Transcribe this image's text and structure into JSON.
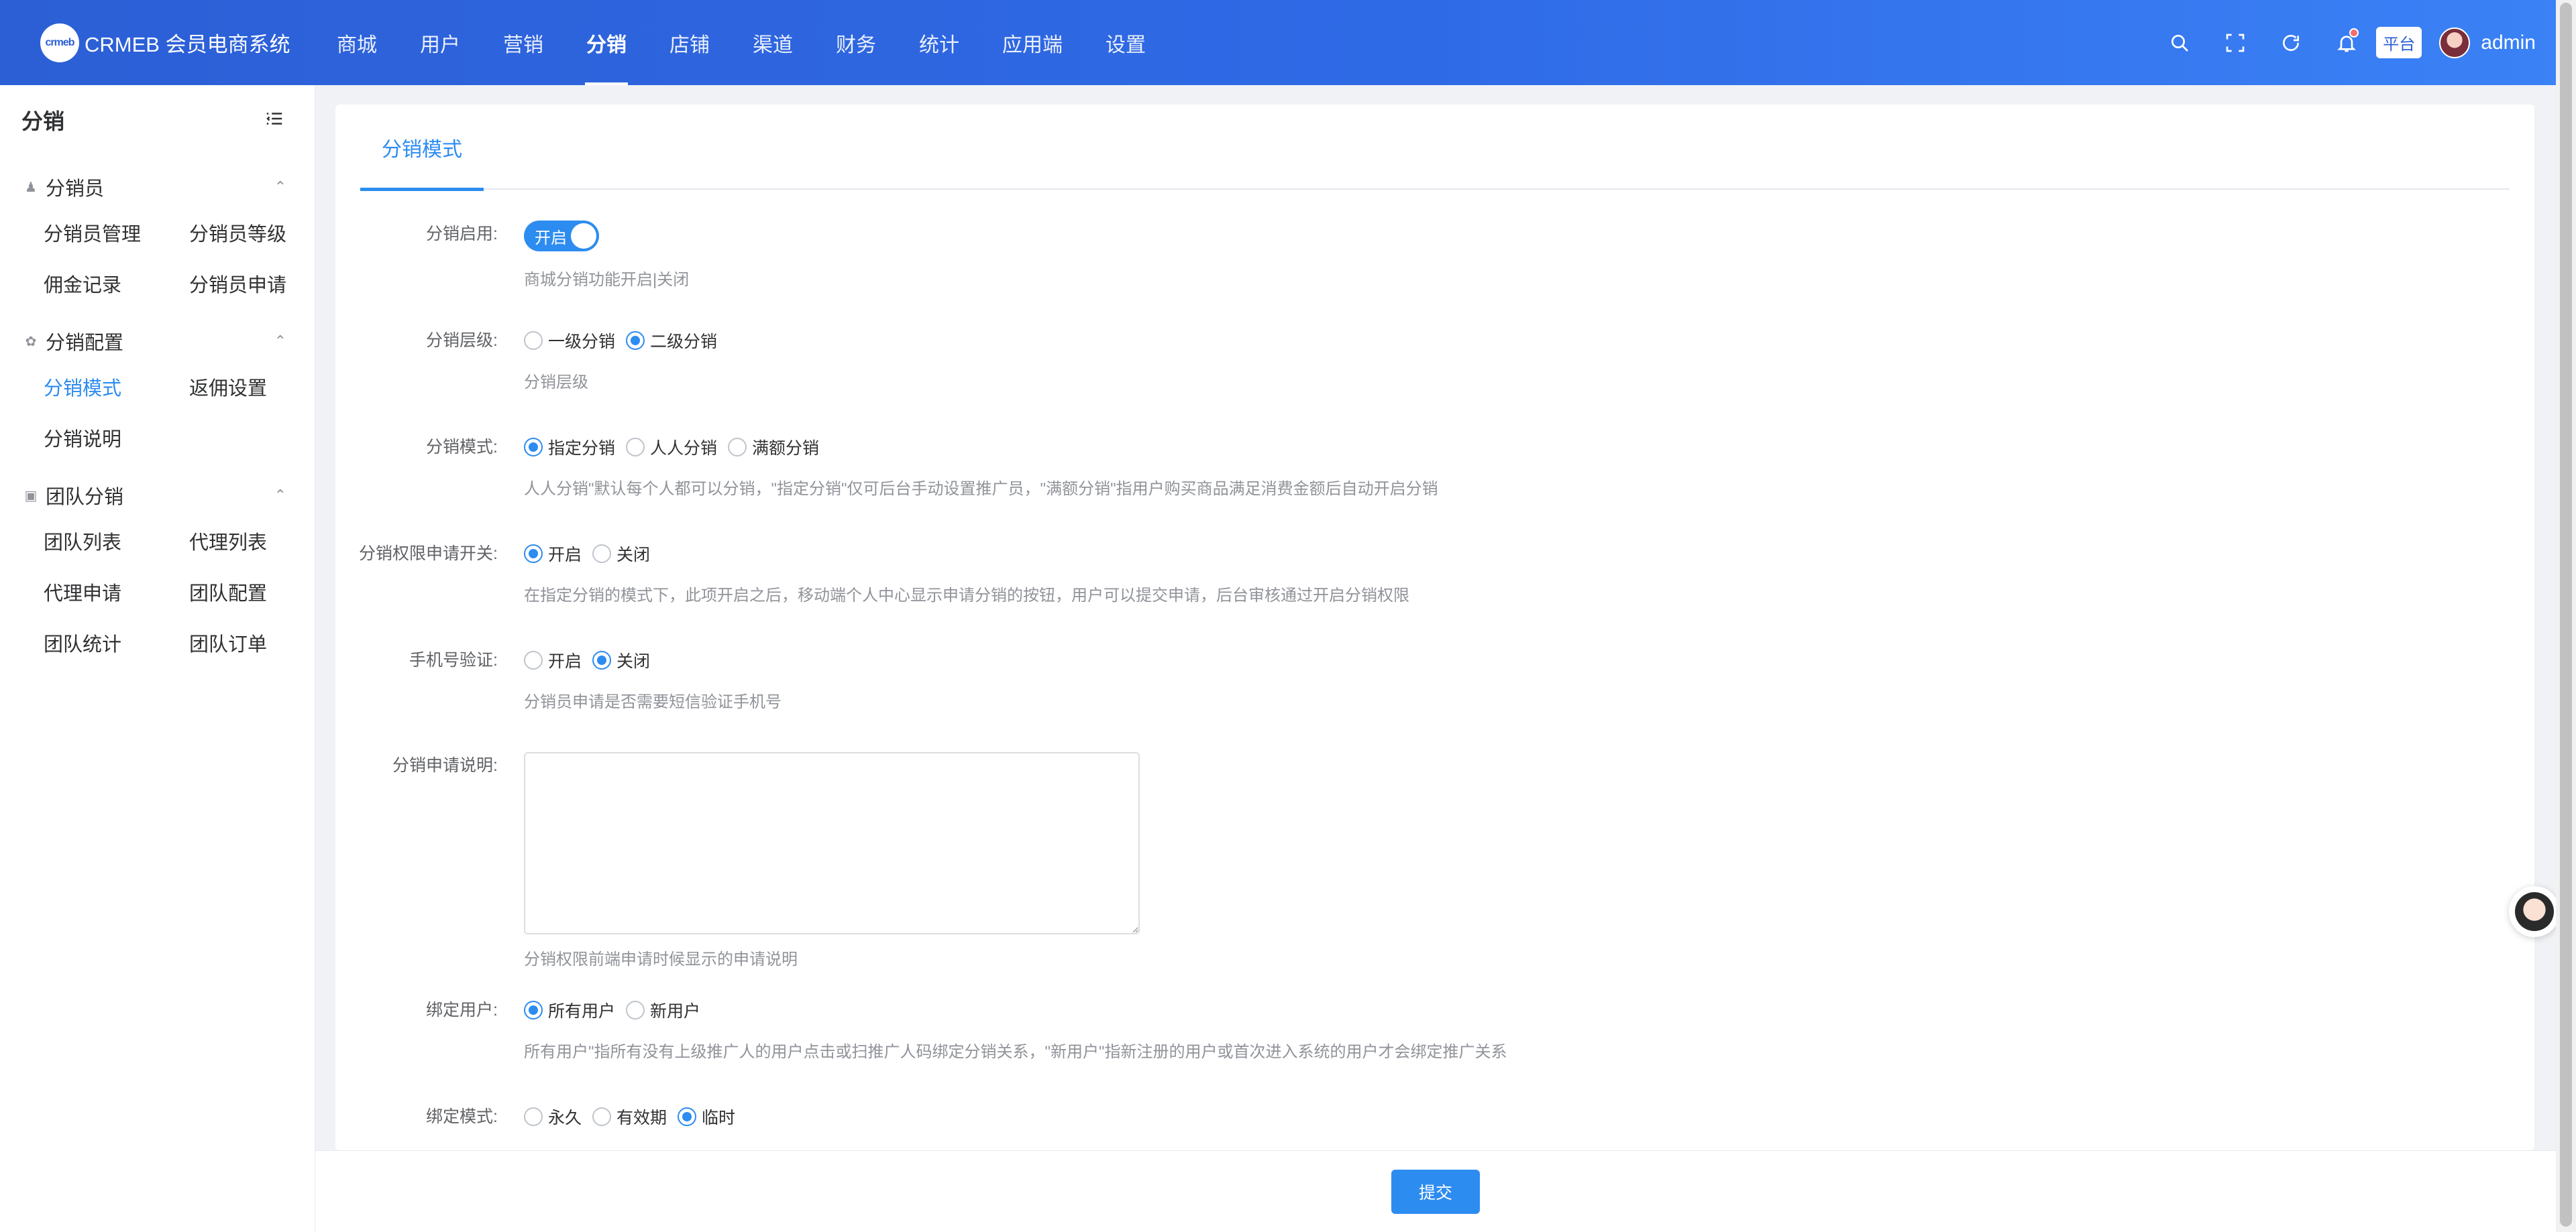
{
  "app": {
    "logo_mark": "crmeb",
    "title": "CRMEB 会员电商系统"
  },
  "topnav": {
    "items": [
      "商城",
      "用户",
      "营销",
      "分销",
      "店铺",
      "渠道",
      "财务",
      "统计",
      "应用端",
      "设置"
    ],
    "active": "分销"
  },
  "topright": {
    "icons": [
      "search-icon",
      "fullscreen-icon",
      "refresh-icon",
      "bell-icon"
    ],
    "badge": "平台",
    "username": "admin"
  },
  "sidebar": {
    "title": "分销",
    "groups": [
      {
        "label": "分销员",
        "icon": "person-icon",
        "items": [
          "分销员管理",
          "分销员等级",
          "佣金记录",
          "分销员申请"
        ]
      },
      {
        "label": "分销配置",
        "icon": "paw-icon",
        "items": [
          "分销模式",
          "返佣设置",
          "分销说明"
        ]
      },
      {
        "label": "团队分销",
        "icon": "box-icon",
        "items": [
          "团队列表",
          "代理列表",
          "代理申请",
          "团队配置",
          "团队统计",
          "团队订单"
        ]
      }
    ],
    "active_item": "分销模式"
  },
  "main": {
    "tab": "分销模式",
    "fields": {
      "enable": {
        "label": "分销启用:",
        "switch_text": "开启",
        "switch_on": true,
        "help": "商城分销功能开启|关闭"
      },
      "level": {
        "label": "分销层级:",
        "options": [
          "一级分销",
          "二级分销"
        ],
        "selected": "二级分销",
        "help": "分销层级"
      },
      "mode": {
        "label": "分销模式:",
        "options": [
          "指定分销",
          "人人分销",
          "满额分销"
        ],
        "selected": "指定分销",
        "help": "人人分销\"默认每个人都可以分销，\"指定分销\"仅可后台手动设置推广员，\"满额分销\"指用户购买商品满足消费金额后自动开启分销"
      },
      "apply_switch": {
        "label": "分销权限申请开关:",
        "options": [
          "开启",
          "关闭"
        ],
        "selected": "开启",
        "help": "在指定分销的模式下，此项开启之后，移动端个人中心显示申请分销的按钮，用户可以提交申请，后台审核通过开启分销权限"
      },
      "phone_verify": {
        "label": "手机号验证:",
        "options": [
          "开启",
          "关闭"
        ],
        "selected": "关闭",
        "help": "分销员申请是否需要短信验证手机号"
      },
      "apply_desc": {
        "label": "分销申请说明:",
        "value": "",
        "help": "分销权限前端申请时候显示的申请说明"
      },
      "bind_user": {
        "label": "绑定用户:",
        "options": [
          "所有用户",
          "新用户"
        ],
        "selected": "所有用户",
        "help": "所有用户\"指所有没有上级推广人的用户点击或扫推广人码绑定分销关系，\"新用户\"指新注册的用户或首次进入系统的用户才会绑定推广关系"
      },
      "bind_mode": {
        "label": "绑定模式:",
        "options": [
          "永久",
          "有效期",
          "临时"
        ],
        "selected": "临时"
      }
    }
  },
  "footer": {
    "submit": "提交"
  },
  "colors": {
    "primary": "#2d8cf0",
    "header_start": "#2c5fd6",
    "header_end": "#3b82f6",
    "help_text": "#909399"
  }
}
